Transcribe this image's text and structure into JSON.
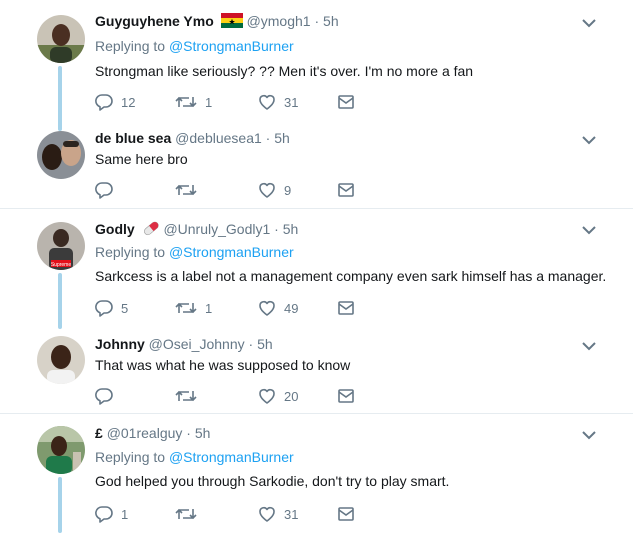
{
  "tweets": [
    {
      "name": "Guyguyhene Ymo",
      "handle": "@ymogh1",
      "time": "5h",
      "replying_prefix": "Replying to",
      "replying_to": "@StrongmanBurner",
      "text": "Strongman like seriously? ?? Men it's over. I'm no more a fan",
      "replies": "12",
      "retweets": "1",
      "likes": "31"
    },
    {
      "name": "de blue sea",
      "handle": "@debluesea1",
      "time": "5h",
      "text": "Same here bro",
      "replies": "",
      "retweets": "",
      "likes": "9"
    },
    {
      "name": "Godly",
      "handle": "@Unruly_Godly1",
      "time": "5h",
      "replying_prefix": "Replying to",
      "replying_to": "@StrongmanBurner",
      "text": "Sarkcess is a label not a management company even sark himself has a manager.",
      "replies": "5",
      "retweets": "1",
      "likes": "49"
    },
    {
      "name": "Johnny",
      "handle": "@Osei_Johnny",
      "time": "5h",
      "text": "That was what he was supposed to know",
      "replies": "",
      "retweets": "",
      "likes": "20"
    },
    {
      "name": "£",
      "handle": "@01realguy",
      "time": "5h",
      "replying_prefix": "Replying to",
      "replying_to": "@StrongmanBurner",
      "text": "God helped you through Sarkodie, don't try to play smart.",
      "replies": "1",
      "retweets": "",
      "likes": "31"
    }
  ],
  "separator": "·",
  "colors": {
    "link": "#1da1f2",
    "muted": "#657786",
    "thread_line": "#a6d3ea",
    "divider": "#e6ecf0"
  },
  "icons": {
    "reply": "reply-icon",
    "retweet": "retweet-icon",
    "like": "heart-icon",
    "dm": "envelope-icon",
    "caret": "chevron-down-icon"
  }
}
